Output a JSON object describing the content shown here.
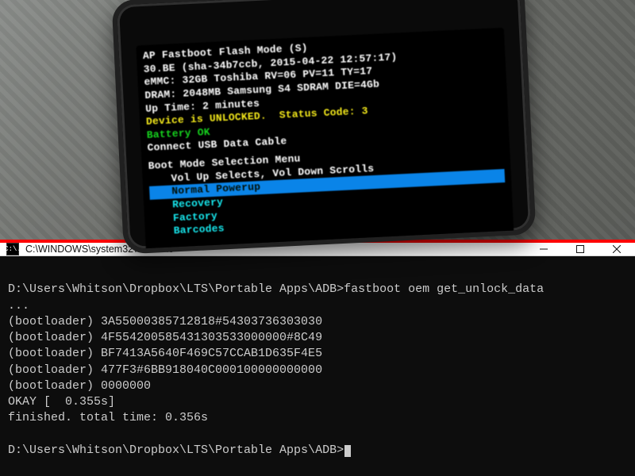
{
  "phone": {
    "header0": "AP Fastboot Flash Mode (S)",
    "header1": "30.BE (sha-34b7ccb, 2015-04-22 12:57:17)",
    "header2": "eMMC: 32GB Toshiba RV=06 PV=11 TY=17",
    "header3": "DRAM: 2048MB Samsung S4 SDRAM DIE=4Gb",
    "header4": "Up Time: 2 minutes",
    "unlocked": "Device is UNLOCKED.  Status Code: 3",
    "battery": "Battery OK",
    "usb": "Connect USB Data Cable",
    "menu_title": "Boot Mode Selection Menu",
    "menu_hint": "Vol Up Selects, Vol Down Scrolls",
    "menu_items": {
      "0": "Normal Powerup",
      "1": "Recovery",
      "2": "Factory",
      "3": "Barcodes"
    }
  },
  "cmd": {
    "title": "C:\\WINDOWS\\system32\\cmd.exe",
    "icon_text": "C:\\.",
    "prompt_path": "D:\\Users\\Whitson\\Dropbox\\LTS\\Portable Apps\\ADB>",
    "command": "fastboot oem get_unlock_data",
    "ellipsis": "...",
    "lines": {
      "0": "(bootloader) 3A55000385712818#54303736303030",
      "1": "(bootloader) 4F554200585431303533000000#8C49",
      "2": "(bootloader) BF7413A5640F469C57CCAB1D635F4E5",
      "3": "(bootloader) 477F3#6BB918040C000100000000000",
      "4": "(bootloader) 0000000"
    },
    "okay": "OKAY [  0.355s]",
    "finished": "finished. total time: 0.356s"
  }
}
